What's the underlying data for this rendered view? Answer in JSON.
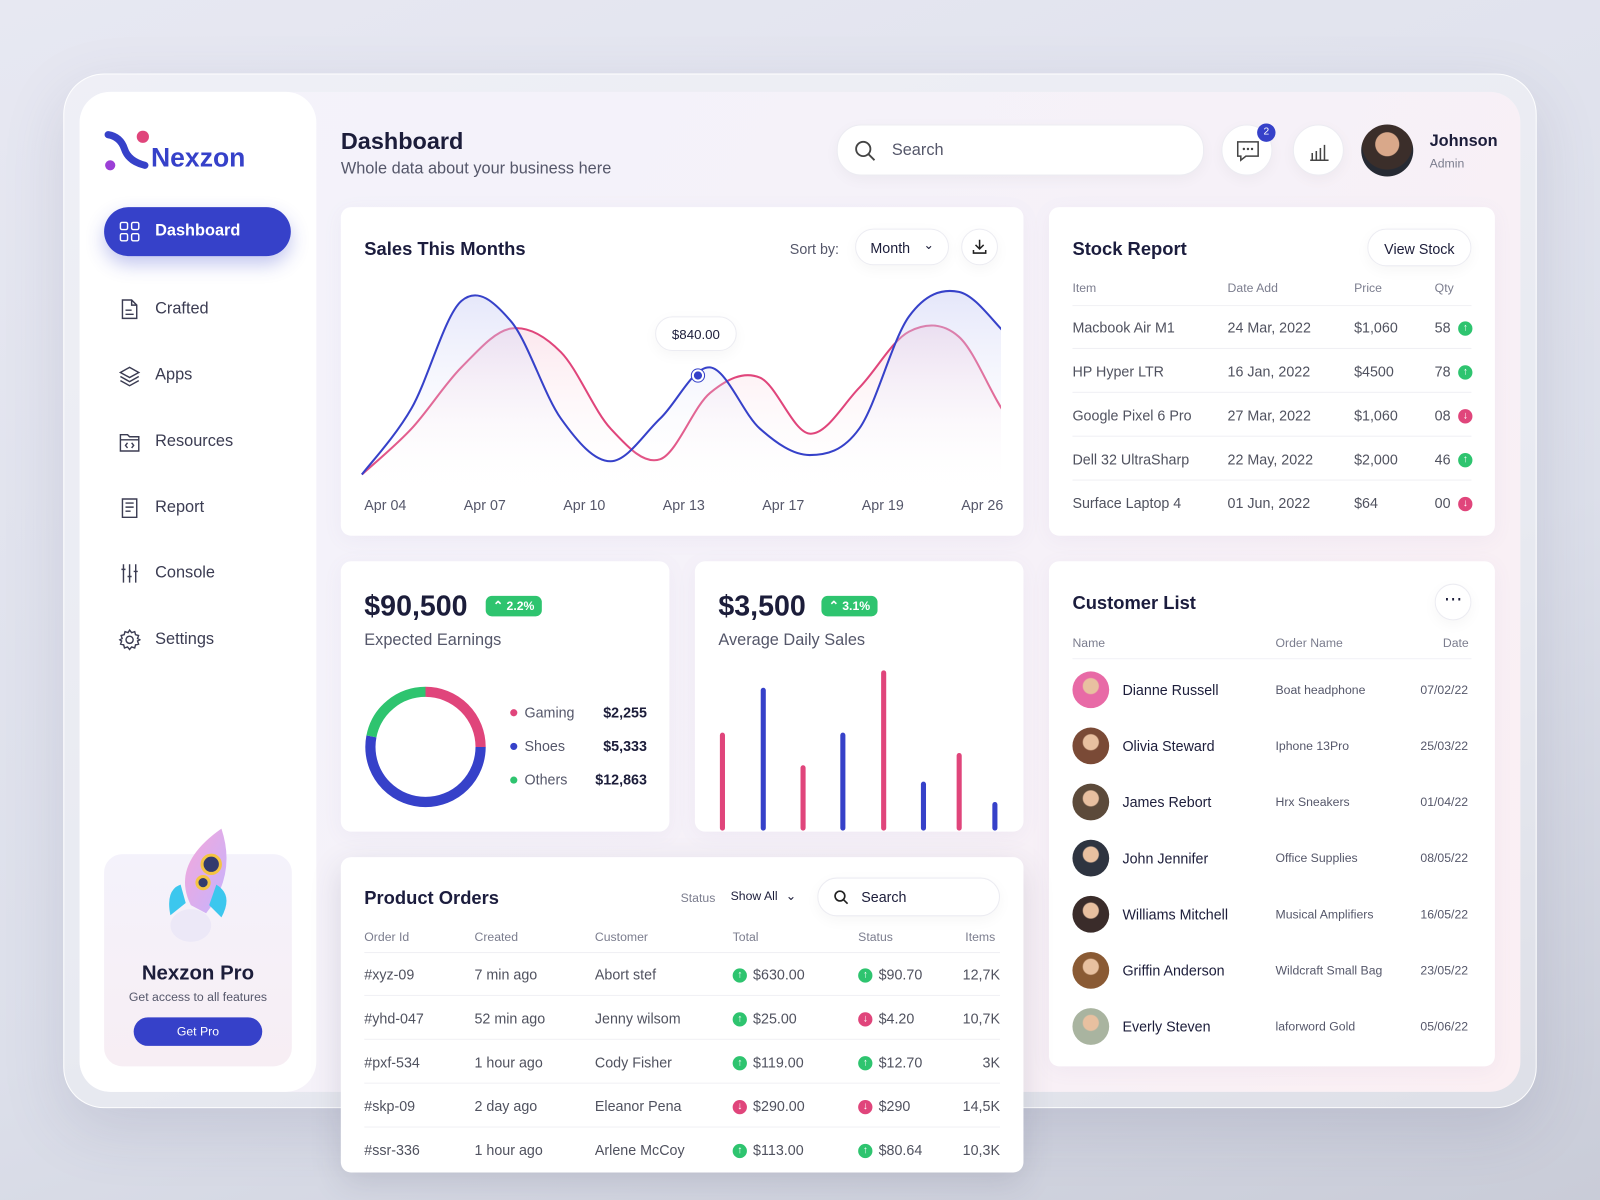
{
  "brand": {
    "name": "Nexzon"
  },
  "header": {
    "title": "Dashboard",
    "subtitle": "Whole data about your business here",
    "search_placeholder": "Search",
    "notification_count": "2",
    "user": {
      "name": "Johnson",
      "role": "Admin"
    }
  },
  "sidebar": {
    "items": [
      {
        "label": "Dashboard",
        "icon": "grid-icon",
        "active": true
      },
      {
        "label": "Crafted",
        "icon": "document-icon"
      },
      {
        "label": "Apps",
        "icon": "layers-icon"
      },
      {
        "label": "Resources",
        "icon": "folder-code-icon"
      },
      {
        "label": "Report",
        "icon": "report-icon"
      },
      {
        "label": "Console",
        "icon": "sliders-icon"
      },
      {
        "label": "Settings",
        "icon": "gear-icon"
      }
    ],
    "promo": {
      "title": "Nexzon Pro",
      "text": "Get access to all features",
      "button": "Get Pro"
    }
  },
  "sales": {
    "title": "Sales This Months",
    "sort_label": "Sort by:",
    "sort_value": "Month",
    "tooltip": "$840.00"
  },
  "chart_data": [
    {
      "type": "line",
      "x_ticks": [
        "Apr 04",
        "Apr 07",
        "Apr 10",
        "Apr 13",
        "Apr 17",
        "Apr 19",
        "Apr 26"
      ],
      "series": [
        {
          "color": "#3641c9",
          "values": [
            41,
            577,
            1442,
            1277,
            494,
            148,
            494,
            906,
            412,
            198,
            412,
            1318,
            1516,
            1154,
            741
          ]
        },
        {
          "color": "#e0457b",
          "values": [
            41,
            412,
            906,
            1220,
            1030,
            412,
            165,
            700,
            824,
            371,
            742,
            1195,
            1154,
            494,
            165
          ]
        }
      ],
      "grid": false,
      "highlight": "$840.00"
    },
    {
      "type": "pie",
      "subtype": "donut",
      "slices": [
        {
          "name": "Gaming",
          "value": "$2,255",
          "share": 0.25,
          "color": "#e0457b"
        },
        {
          "name": "Shoes",
          "value": "$5,333",
          "share": 0.53,
          "color": "#3641c9"
        },
        {
          "name": "Others",
          "value": "$12,863",
          "share": 0.22,
          "color": "#2ec46f"
        }
      ]
    },
    {
      "type": "bar",
      "values": [
        96,
        140,
        64,
        96,
        157,
        48,
        76,
        28
      ],
      "colors": [
        "#e0457b",
        "#3641c9"
      ],
      "grid": false
    }
  ],
  "earnings": {
    "amount": "$90,500",
    "change": "2.2%",
    "label": "Expected Earnings"
  },
  "daily": {
    "amount": "$3,500",
    "change": "3.1%",
    "label": "Average Daily Sales"
  },
  "stock": {
    "title": "Stock Report",
    "button": "View Stock",
    "columns": [
      "Item",
      "Date Add",
      "Price",
      "Qty"
    ],
    "rows": [
      {
        "item": "Macbook Air M1",
        "date": "24 Mar, 2022",
        "price": "$1,060",
        "qty": "58",
        "trend": "up"
      },
      {
        "item": "HP Hyper LTR",
        "date": "16 Jan, 2022",
        "price": "$4500",
        "qty": "78",
        "trend": "up"
      },
      {
        "item": "Google Pixel 6 Pro",
        "date": "27 Mar, 2022",
        "price": "$1,060",
        "qty": "08",
        "trend": "down"
      },
      {
        "item": "Dell 32 UltraSharp",
        "date": "22 May, 2022",
        "price": "$2,000",
        "qty": "46",
        "trend": "up"
      },
      {
        "item": "Surface Laptop 4",
        "date": "01 Jun, 2022",
        "price": "$64",
        "qty": "00",
        "trend": "down"
      }
    ]
  },
  "customers": {
    "title": "Customer List",
    "columns": [
      "Name",
      "Order Name",
      "Date"
    ],
    "rows": [
      {
        "name": "Dianne Russell",
        "order": "Boat headphone",
        "date": "07/02/22",
        "color": "#e86aa6"
      },
      {
        "name": "Olivia Steward",
        "order": "Iphone 13Pro",
        "date": "25/03/22",
        "color": "#7a4a36"
      },
      {
        "name": "James Rebort",
        "order": "Hrx Sneakers",
        "date": "01/04/22",
        "color": "#5c4a3a"
      },
      {
        "name": "John Jennifer",
        "order": "Office Supplies",
        "date": "08/05/22",
        "color": "#2e3440"
      },
      {
        "name": "Williams Mitchell",
        "order": "Musical Amplifiers",
        "date": "16/05/22",
        "color": "#3a2c2a"
      },
      {
        "name": "Griffin Anderson",
        "order": "Wildcraft Small Bag",
        "date": "23/05/22",
        "color": "#8a5a34"
      },
      {
        "name": "Everly Steven",
        "order": "laforword Gold",
        "date": "05/06/22",
        "color": "#a9b4a0"
      }
    ]
  },
  "orders": {
    "title": "Product Orders",
    "status_label": "Status",
    "status_value": "Show All",
    "search_placeholder": "Search",
    "columns": [
      "Order Id",
      "Created",
      "Customer",
      "Total",
      "Status",
      "Items"
    ],
    "rows": [
      {
        "id": "#xyz-09",
        "created": "7 min ago",
        "customer": "Abort stef",
        "total": "$630.00",
        "total_trend": "up",
        "status": "$90.70",
        "status_trend": "up",
        "items": "12,7K"
      },
      {
        "id": "#yhd-047",
        "created": "52 min ago",
        "customer": "Jenny wilsom",
        "total": "$25.00",
        "total_trend": "up",
        "status": "$4.20",
        "status_trend": "down",
        "items": "10,7K"
      },
      {
        "id": "#pxf-534",
        "created": "1 hour ago",
        "customer": "Cody Fisher",
        "total": "$119.00",
        "total_trend": "up",
        "status": "$12.70",
        "status_trend": "up",
        "items": "3K"
      },
      {
        "id": "#skp-09",
        "created": "2 day ago",
        "customer": "Eleanor Pena",
        "total": "$290.00",
        "total_trend": "down",
        "status": "$290",
        "status_trend": "down",
        "items": "14,5K"
      },
      {
        "id": "#ssr-336",
        "created": "1 hour ago",
        "customer": "Arlene McCoy",
        "total": "$113.00",
        "total_trend": "up",
        "status": "$80.64",
        "status_trend": "up",
        "items": "10,3K"
      }
    ]
  },
  "colors": {
    "accent": "#3641c9",
    "pink": "#e0457b",
    "green": "#2ec46f"
  }
}
